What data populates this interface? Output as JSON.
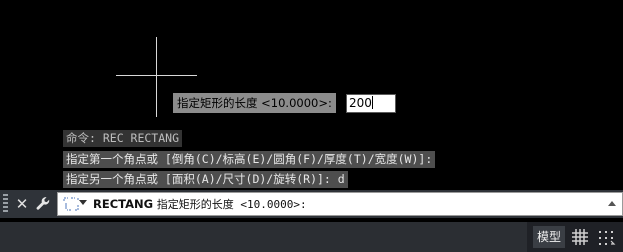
{
  "canvas": {
    "dynamic_prompt_label": "指定矩形的长度 <10.0000>:",
    "dynamic_input_value": "200"
  },
  "history": [
    "命令: REC RECTANG",
    "指定第一个角点或 [倒角(C)/标高(E)/圆角(F)/厚度(T)/宽度(W)]:",
    "指定另一个角点或 [面积(A)/尺寸(D)/旋转(R)]: d"
  ],
  "command_bar": {
    "command_name": "RECTANG",
    "prompt": "指定矩形的长度 <10.0000>:",
    "close_icon": "close-icon",
    "customize_icon": "wrench-icon",
    "recent_icon": "command-prompt-icon"
  },
  "status_bar": {
    "model_label": "模型",
    "icons": [
      "grid-icon",
      "snap-icon"
    ]
  },
  "colors": {
    "background": "#000000",
    "crosshair": "#d8d8d8",
    "command_bar": "#2f3339",
    "status_bar": "#1f2126"
  }
}
